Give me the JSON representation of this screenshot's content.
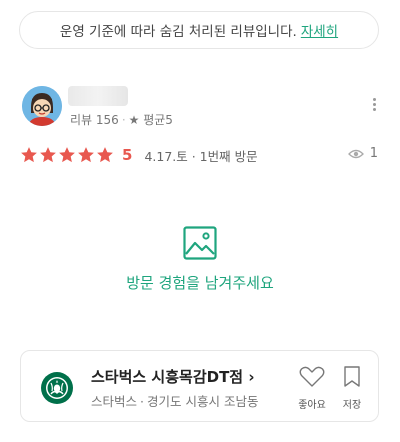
{
  "notice": {
    "text": "운영 기준에 따라 숨김 처리된 리뷰입니다.",
    "link": "자세히"
  },
  "reviewer": {
    "review_label": "리뷰 156",
    "avg_label": "★ 평균5",
    "avatar_icon": "cartoon-avatar-icon",
    "menu_icon": "more-vertical-icon"
  },
  "review": {
    "rating": 5,
    "stars_max": 5,
    "star_color": "#e8584f",
    "score": "5",
    "date": "4.17.토 · 1번째 방문",
    "views": "1",
    "views_icon": "eye-icon"
  },
  "empty_photo": {
    "icon": "image-icon",
    "prompt": "방문 경험을 남겨주세요",
    "accent": "#1fa57e"
  },
  "place": {
    "logo_icon": "starbucks-logo-icon",
    "name": "스타벅스 시흥목감DT점 ›",
    "brand": "스타벅스",
    "location": "경기도 시흥시 조남동",
    "like_label": "좋아요",
    "like_icon": "heart-outline-icon",
    "save_label": "저장",
    "save_icon": "bookmark-icon"
  }
}
